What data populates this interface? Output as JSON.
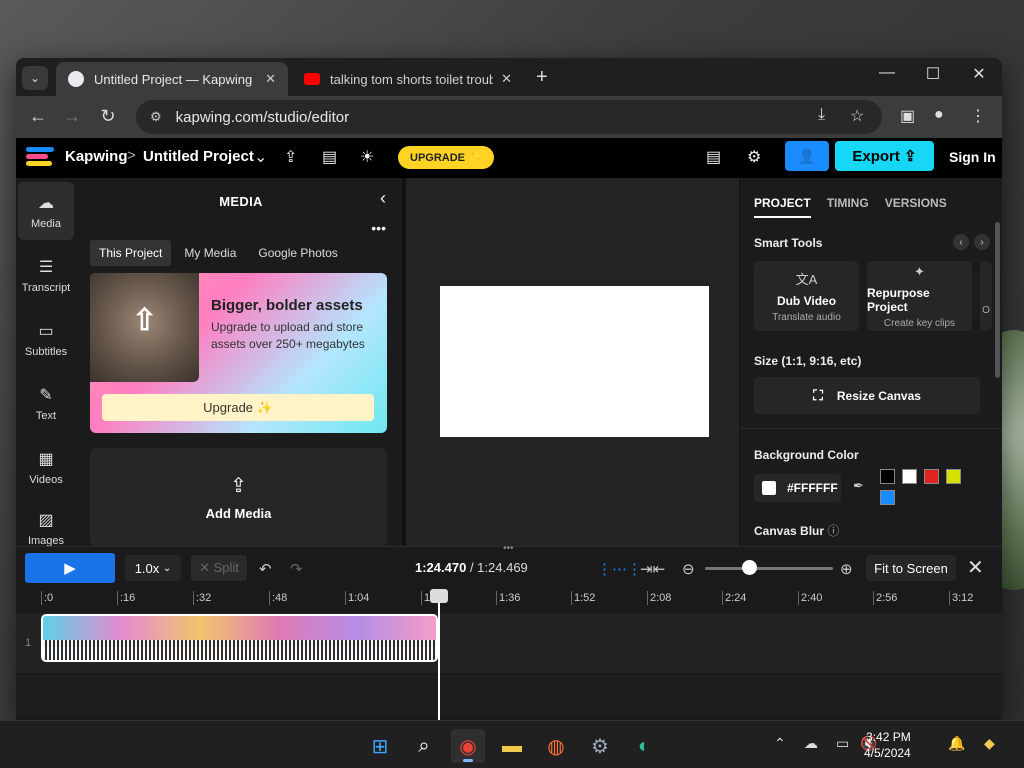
{
  "browser": {
    "tabs": [
      {
        "title": "Untitled Project — Kapwing",
        "favicon_color": "#e8eaed"
      },
      {
        "title": "talking tom shorts toilet trouble",
        "favicon_color": "#ff0000"
      }
    ],
    "url": "kapwing.com/studio/editor"
  },
  "header": {
    "brand": "Kapwing",
    "separator": ">",
    "project_name": "Untitled Project",
    "upgrade_label": "UPGRADE ✨",
    "export_label": "Export",
    "signin_label": "Sign In"
  },
  "rail": {
    "items": [
      {
        "label": "Media",
        "icon": "upload-cloud-icon"
      },
      {
        "label": "Transcript",
        "icon": "transcript-icon"
      },
      {
        "label": "Subtitles",
        "icon": "subtitles-icon"
      },
      {
        "label": "Text",
        "icon": "text-icon"
      },
      {
        "label": "Videos",
        "icon": "film-icon"
      },
      {
        "label": "Images",
        "icon": "image-icon"
      }
    ]
  },
  "media": {
    "title": "MEDIA",
    "tabs": [
      "This Project",
      "My Media",
      "Google Photos"
    ],
    "promo_heading": "Bigger, bolder assets",
    "promo_body": "Upgrade to upload and store assets over 250+ megabytes",
    "promo_button": "Upgrade ✨",
    "add_media": "Add Media"
  },
  "right_panel": {
    "tabs": [
      "PROJECT",
      "TIMING",
      "VERSIONS"
    ],
    "smart_tools_label": "Smart Tools",
    "tools": [
      {
        "title": "Dub Video",
        "subtitle": "Translate audio"
      },
      {
        "title": "Repurpose Project",
        "subtitle": "Create key clips"
      }
    ],
    "tool_overflow": "O",
    "size_label": "Size (1:1, 9:16, etc)",
    "resize_label": "Resize Canvas",
    "bg_color_label": "Background Color",
    "bg_color_value": "#FFFFFF",
    "presets": [
      "#000000",
      "#ffffff",
      "#e32222",
      "#d4e000",
      "#1a8cff"
    ],
    "canvas_blur_label": "Canvas Blur"
  },
  "timeline": {
    "speed": "1.0x",
    "split_label": "✕ Split",
    "current_time": "1:24.470",
    "total_time": "/ 1:24.469",
    "fit_label": "Fit to Screen",
    "track_number": "1",
    "ticks": [
      ":0",
      ":16",
      ":32",
      ":48",
      "1:04",
      "1:20",
      "1:36",
      "1:52",
      "2:08",
      "2:24",
      "2:40",
      "2:56",
      "3:12"
    ]
  },
  "taskbar": {
    "time": "3:42 PM",
    "date": "4/5/2024"
  }
}
